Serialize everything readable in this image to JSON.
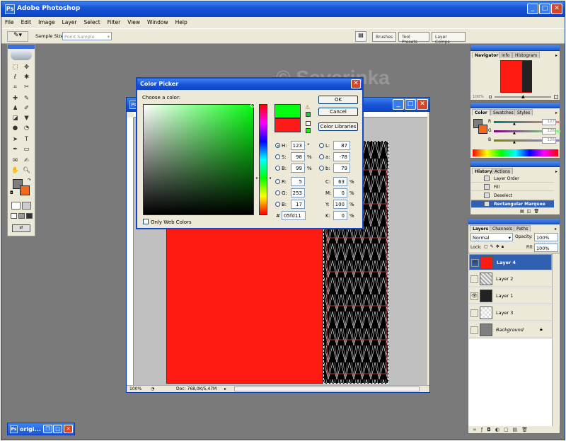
{
  "window": {
    "title": "Adobe Photoshop"
  },
  "menu": [
    "File",
    "Edit",
    "Image",
    "Layer",
    "Select",
    "Filter",
    "View",
    "Window",
    "Help"
  ],
  "options_bar": {
    "sample_size_label": "Sample Size:",
    "sample_size_value": "Point Sample"
  },
  "palette_well": {
    "tabs": [
      "Brushes",
      "Tool Presets",
      "Layer Comps"
    ]
  },
  "watermark": "© Severinka",
  "color_picker": {
    "title": "Color Picker",
    "choose_label": "Choose a color:",
    "ok_label": "OK",
    "cancel_label": "Cancel",
    "libraries_label": "Color Libraries",
    "web_only_label": "Only Web Colors",
    "new_color": "#05fd11",
    "current_color": "#ff1a1a",
    "fields": {
      "H": {
        "label": "H:",
        "value": "123",
        "unit": "°"
      },
      "S": {
        "label": "S:",
        "value": "98",
        "unit": "%"
      },
      "Bv": {
        "label": "B:",
        "value": "99",
        "unit": "%"
      },
      "R": {
        "label": "R:",
        "value": "5"
      },
      "G": {
        "label": "G:",
        "value": "253"
      },
      "Bc": {
        "label": "B:",
        "value": "17"
      },
      "L": {
        "label": "L:",
        "value": "87"
      },
      "a": {
        "label": "a:",
        "value": "-78"
      },
      "b": {
        "label": "b:",
        "value": "79"
      },
      "C": {
        "label": "C:",
        "value": "63",
        "unit": "%"
      },
      "M": {
        "label": "M:",
        "value": "0",
        "unit": "%"
      },
      "Y": {
        "label": "Y:",
        "value": "100",
        "unit": "%"
      },
      "K": {
        "label": "K:",
        "value": "0",
        "unit": "%"
      }
    },
    "hex_label": "#",
    "hex": "05fd11"
  },
  "document": {
    "zoom": "100%",
    "doc_info": "Doc: 768,0K/5,47M"
  },
  "navigator": {
    "tabs": [
      "Navigator",
      "Info",
      "Histogram"
    ],
    "zoom": "100%"
  },
  "color_panel": {
    "tabs": [
      "Color",
      "Swatches",
      "Styles"
    ],
    "channels": [
      {
        "label": "R",
        "value": "127"
      },
      {
        "label": "G",
        "value": "126"
      },
      {
        "label": "B",
        "value": "126"
      }
    ]
  },
  "history": {
    "tabs": [
      "History",
      "Actions"
    ],
    "items": [
      "Layer Order",
      "Fill",
      "Deselect",
      "Rectangular Marquee"
    ]
  },
  "layers": {
    "tabs": [
      "Layers",
      "Channels",
      "Paths"
    ],
    "blend_mode": "Normal",
    "opacity_label": "Opacity:",
    "opacity": "100%",
    "lock_label": "Lock:",
    "fill_label": "Fill:",
    "fill": "100%",
    "items": [
      "Layer 4",
      "Layer 2",
      "Layer 1",
      "Layer 3",
      "Background"
    ]
  },
  "taskbar": {
    "label": "origi..."
  }
}
